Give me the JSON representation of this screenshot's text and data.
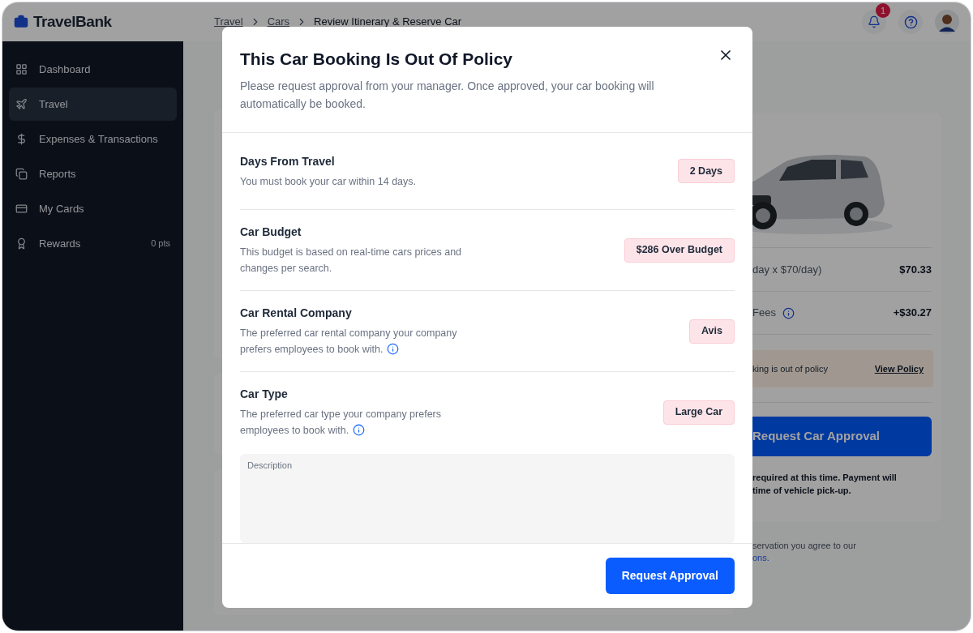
{
  "header": {
    "logo": "TravelBank",
    "breadcrumbs": [
      {
        "label": "Travel",
        "link": true
      },
      {
        "label": "Cars",
        "link": true
      },
      {
        "label": "Review Itinerary & Reserve Car",
        "link": false
      }
    ],
    "notifications_badge": "1"
  },
  "sidebar": {
    "items": [
      {
        "label": "Dashboard",
        "selected": false
      },
      {
        "label": "Travel",
        "selected": true
      },
      {
        "label": "Expenses & Transactions",
        "selected": false
      },
      {
        "label": "Reports",
        "selected": false
      },
      {
        "label": "My Cards",
        "selected": false
      },
      {
        "label": "Rewards",
        "selected": false,
        "count": "0 pts"
      }
    ]
  },
  "summary": {
    "rate_label": "day x $70/day)",
    "rate_value": "$70.33",
    "fees_label": "Fees",
    "fees_value": "+$30.27",
    "policy_notice": "king is out of policy",
    "policy_link": "View Policy",
    "button": "Request Car Approval",
    "note": [
      "required at this time. Payment will",
      "time of vehicle pick-up."
    ],
    "terms": "servation you agree to our",
    "terms_link": "ons."
  },
  "modal": {
    "title": "This Car Booking Is Out Of Policy",
    "subtitle": "Please request approval from your manager. Once approved, your car booking will automatically be booked.",
    "criteria": [
      {
        "title": "Days From Travel",
        "description": "You must book your car within 14 days.",
        "info": false,
        "value": "2 Days"
      },
      {
        "title": "Car Budget",
        "description": "This budget is based on real-time cars prices and changes per search.",
        "info": false,
        "value": "$286 Over Budget"
      },
      {
        "title": "Car Rental Company",
        "description": "The preferred car rental company your company prefers employees to book with.",
        "info": true,
        "value": "Avis"
      },
      {
        "title": "Car Type",
        "description": "The preferred car type your company prefers employees to book with.",
        "info": true,
        "value": "Large Car"
      }
    ],
    "description_placeholder": "Description",
    "submit": "Request Approval"
  }
}
